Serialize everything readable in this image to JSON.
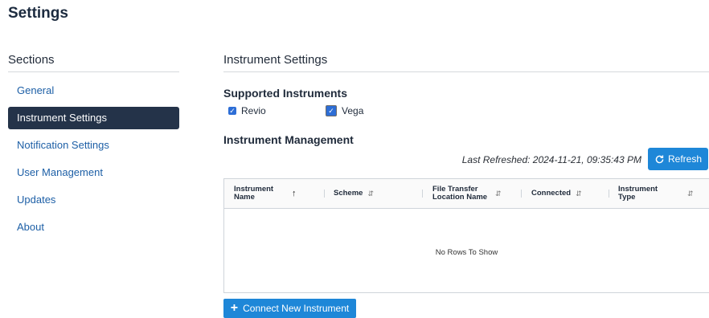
{
  "page": {
    "title": "Settings"
  },
  "sidebar": {
    "heading": "Sections",
    "items": [
      {
        "label": "General",
        "active": false
      },
      {
        "label": "Instrument Settings",
        "active": true
      },
      {
        "label": "Notification Settings",
        "active": false
      },
      {
        "label": "User Management",
        "active": false
      },
      {
        "label": "Updates",
        "active": false
      },
      {
        "label": "About",
        "active": false
      }
    ]
  },
  "main": {
    "heading": "Instrument Settings",
    "supported": {
      "heading": "Supported Instruments",
      "instruments": [
        {
          "label": "Revio",
          "checked": true
        },
        {
          "label": "Vega",
          "checked": true
        }
      ]
    },
    "management": {
      "heading": "Instrument Management",
      "last_refreshed": "Last Refreshed: 2024-11-21, 09:35:43 PM",
      "refresh_label": "Refresh",
      "refresh_icon": "refresh-icon",
      "columns": [
        {
          "label": "Instrument Name",
          "sort": "asc"
        },
        {
          "label": "Scheme",
          "sort": "none"
        },
        {
          "label": "File Transfer Location Name",
          "sort": "none"
        },
        {
          "label": "Connected",
          "sort": "none"
        },
        {
          "label": "Instrument Type",
          "sort": "none"
        }
      ],
      "empty_text": "No Rows To Show",
      "connect_label": "Connect New Instrument",
      "connect_icon": "plus-icon"
    }
  },
  "colors": {
    "accent": "#1e87d8",
    "nav_active_bg": "#243349",
    "link": "#1d5fa6"
  }
}
